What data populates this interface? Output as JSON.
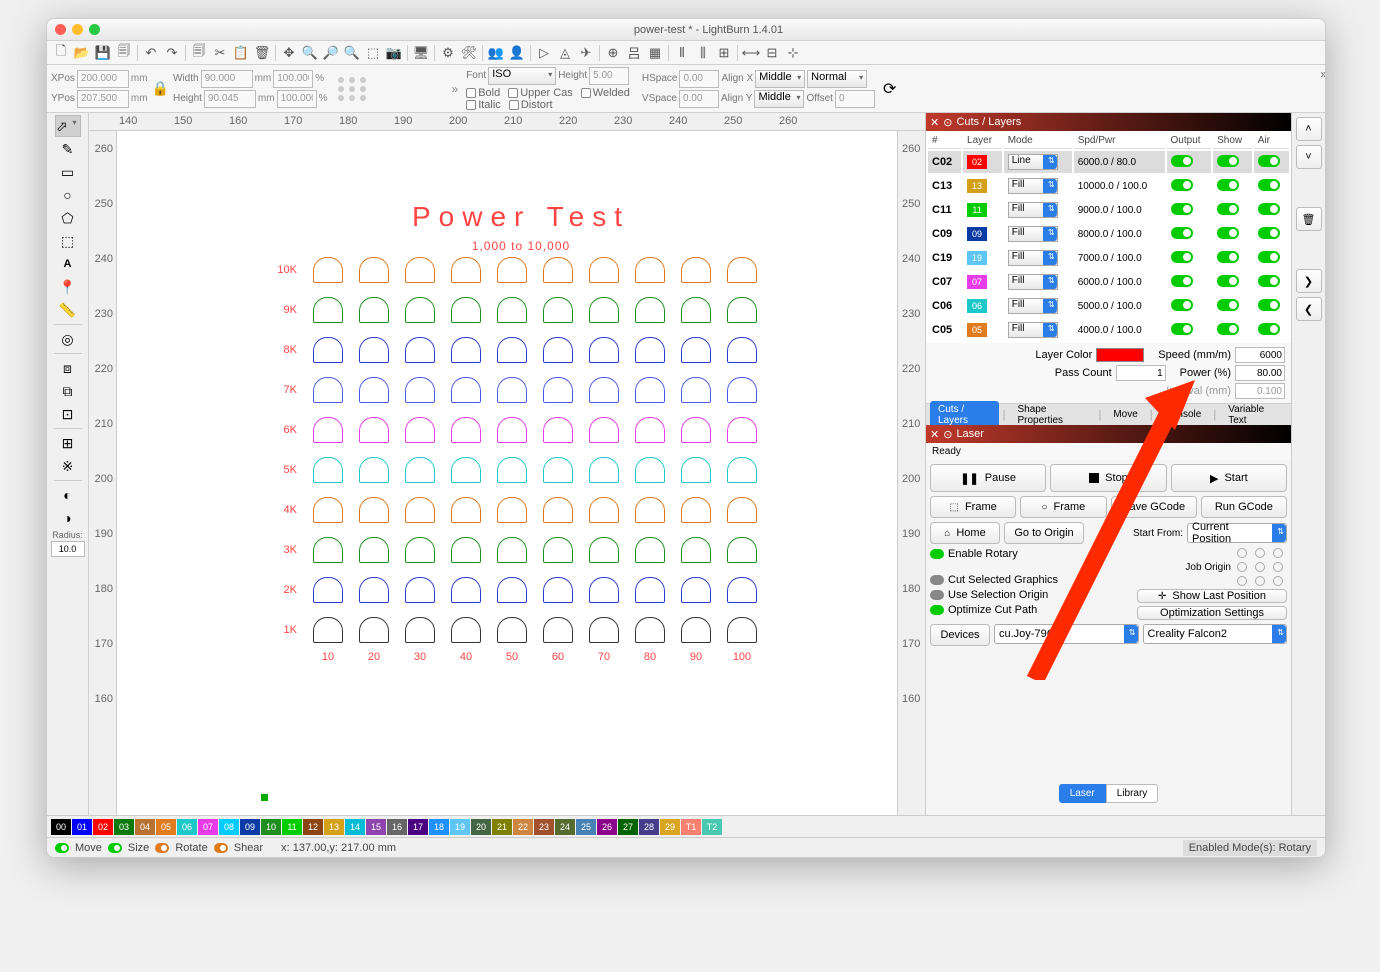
{
  "title": "power-test * - LightBurn 1.4.01",
  "props": {
    "xpos_lbl": "XPos",
    "xpos": "200.000",
    "ypos_lbl": "YPos",
    "ypos": "207.500",
    "mm": "mm",
    "width_lbl": "Width",
    "width": "90.000",
    "height_lbl": "Height",
    "height": "90.045",
    "wpct": "100.000",
    "hpct": "100.000",
    "pct": "%",
    "bold": "Bold",
    "italic": "Italic",
    "upper": "Upper Cas",
    "distort": "Distort",
    "welded": "Welded",
    "font_lbl": "Font",
    "font": "ISO",
    "fh_lbl": "Height",
    "fh": "5.00",
    "hspace_lbl": "HSpace",
    "hspace": "0.00",
    "vspace_lbl": "VSpace",
    "vspace": "0.00",
    "alignx_lbl": "Align X",
    "alignx": "Middle",
    "aligny_lbl": "Align Y",
    "aligny": "Middle",
    "normal": "Normal",
    "offset_lbl": "Offset",
    "offset": "0"
  },
  "radius_lbl": "Radius:",
  "radius": "10.0",
  "ruler_h": [
    "140",
    "150",
    "160",
    "170",
    "180",
    "190",
    "200",
    "210",
    "220",
    "230",
    "240",
    "250",
    "260"
  ],
  "ruler_v": [
    "260",
    "250",
    "240",
    "230",
    "220",
    "210",
    "200",
    "190",
    "180",
    "170",
    "160"
  ],
  "canvas": {
    "title": "Power Test",
    "sub": "1,000 to 10,000"
  },
  "rows": [
    {
      "lbl": "10K",
      "color": "#e07b1e"
    },
    {
      "lbl": "9K",
      "color": "#1e8f1e"
    },
    {
      "lbl": "8K",
      "color": "#2b3bd6"
    },
    {
      "lbl": "7K",
      "color": "#4a5aea"
    },
    {
      "lbl": "6K",
      "color": "#e83be8"
    },
    {
      "lbl": "5K",
      "color": "#1ec8c8"
    },
    {
      "lbl": "4K",
      "color": "#e07b1e"
    },
    {
      "lbl": "3K",
      "color": "#1e8f1e"
    },
    {
      "lbl": "2K",
      "color": "#2b3bd6"
    },
    {
      "lbl": "1K",
      "color": "#333"
    }
  ],
  "cols": [
    "10",
    "20",
    "30",
    "40",
    "50",
    "60",
    "70",
    "80",
    "90",
    "100"
  ],
  "palette": [
    {
      "n": "00",
      "c": "#000"
    },
    {
      "n": "01",
      "c": "#00f"
    },
    {
      "n": "02",
      "c": "#f00"
    },
    {
      "n": "03",
      "c": "#0b7a0b"
    },
    {
      "n": "04",
      "c": "#b87333"
    },
    {
      "n": "05",
      "c": "#e07b1e"
    },
    {
      "n": "06",
      "c": "#1ec8c8"
    },
    {
      "n": "07",
      "c": "#e83be8"
    },
    {
      "n": "08",
      "c": "#0cf"
    },
    {
      "n": "09",
      "c": "#0b3ba5"
    },
    {
      "n": "10",
      "c": "#1e8f1e"
    },
    {
      "n": "11",
      "c": "#0c0"
    },
    {
      "n": "12",
      "c": "#8b4513"
    },
    {
      "n": "13",
      "c": "#d4a017"
    },
    {
      "n": "14",
      "c": "#00bcd4"
    },
    {
      "n": "15",
      "c": "#8e44ad"
    },
    {
      "n": "16",
      "c": "#666"
    },
    {
      "n": "17",
      "c": "#4b0082"
    },
    {
      "n": "18",
      "c": "#1e90ff"
    },
    {
      "n": "19",
      "c": "#5fc5f5"
    },
    {
      "n": "20",
      "c": "#446644"
    },
    {
      "n": "21",
      "c": "#808000"
    },
    {
      "n": "22",
      "c": "#cd853f"
    },
    {
      "n": "23",
      "c": "#a0522d"
    },
    {
      "n": "24",
      "c": "#556b2f"
    },
    {
      "n": "25",
      "c": "#4682b4"
    },
    {
      "n": "26",
      "c": "#8b008b"
    },
    {
      "n": "27",
      "c": "#006400"
    },
    {
      "n": "28",
      "c": "#483d8b"
    },
    {
      "n": "29",
      "c": "#daa520"
    },
    {
      "n": "T1",
      "c": "#fa8072"
    },
    {
      "n": "T2",
      "c": "#48c9b0"
    }
  ],
  "status": {
    "move": "Move",
    "size": "Size",
    "rotate": "Rotate",
    "shear": "Shear",
    "coords": "x: 137.00,y: 217.00 mm",
    "mode": "Enabled Mode(s): Rotary"
  },
  "cuts": {
    "title": "Cuts / Layers",
    "hdr": {
      "n": "#",
      "layer": "Layer",
      "mode": "Mode",
      "sp": "Spd/Pwr",
      "out": "Output",
      "show": "Show",
      "air": "Air"
    },
    "rows": [
      {
        "n": "C02",
        "sw": "02",
        "c": "#f00",
        "mode": "Line",
        "sp": "6000.0 / 80.0",
        "sel": true
      },
      {
        "n": "C13",
        "sw": "13",
        "c": "#d4a017",
        "mode": "Fill",
        "sp": "10000.0 / 100.0"
      },
      {
        "n": "C11",
        "sw": "11",
        "c": "#0c0",
        "mode": "Fill",
        "sp": "9000.0 / 100.0"
      },
      {
        "n": "C09",
        "sw": "09",
        "c": "#0b3ba5",
        "mode": "Fill",
        "sp": "8000.0 / 100.0"
      },
      {
        "n": "C19",
        "sw": "19",
        "c": "#5fc5f5",
        "mode": "Fill",
        "sp": "7000.0 / 100.0"
      },
      {
        "n": "C07",
        "sw": "07",
        "c": "#e83be8",
        "mode": "Fill",
        "sp": "6000.0 / 100.0"
      },
      {
        "n": "C06",
        "sw": "06",
        "c": "#1ec8c8",
        "mode": "Fill",
        "sp": "5000.0 / 100.0"
      },
      {
        "n": "C05",
        "sw": "05",
        "c": "#e07b1e",
        "mode": "Fill",
        "sp": "4000.0 / 100.0"
      }
    ],
    "lp": {
      "color_lbl": "Layer Color",
      "speed_lbl": "Speed (mm/m)",
      "speed": "6000",
      "pass_lbl": "Pass Count",
      "pass": "1",
      "pwr_lbl": "Power (%)",
      "pwr": "80.00",
      "int_lbl": "Interval (mm)",
      "int": "0.100"
    },
    "tabs": [
      "Cuts / Layers",
      "Shape Properties",
      "Move",
      "Console",
      "Variable Text"
    ]
  },
  "laser": {
    "title": "Laser",
    "ready": "Ready",
    "pause": "Pause",
    "stop": "Stop",
    "start": "Start",
    "frame1": "Frame",
    "frame2": "Frame",
    "save": "Save GCode",
    "run": "Run GCode",
    "home": "Home",
    "origin": "Go to Origin",
    "start_from_lbl": "Start From:",
    "start_from": "Current Position",
    "enable_rotary": "Enable Rotary",
    "job_origin": "Job Origin",
    "cut_sel": "Cut Selected Graphics",
    "use_sel": "Use Selection Origin",
    "opt_path": "Optimize Cut Path",
    "show_last": "Show Last Position",
    "opt_set": "Optimization Settings",
    "devices": "Devices",
    "port": "cu.Joy-79CB",
    "machine": "Creality Falcon2",
    "tab_laser": "Laser",
    "tab_library": "Library"
  }
}
